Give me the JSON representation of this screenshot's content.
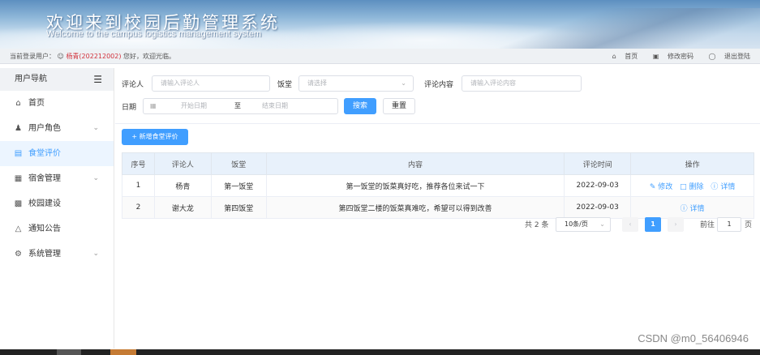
{
  "header": {
    "title_cn": "欢迎来到校园后勤管理系统",
    "title_en": "Welcome to the campus logistics management system"
  },
  "infobar": {
    "current_user_prefix": "当前登录用户：",
    "user": "杨青(202212002)",
    "greeting": "您好，欢迎光临。",
    "links": [
      "首页",
      "修改密码",
      "退出登陆"
    ]
  },
  "sidebar": {
    "title": "用户导航",
    "items": [
      {
        "label": "首页",
        "icon": "home-icon",
        "has_children": false,
        "active": false
      },
      {
        "label": "用户角色",
        "icon": "user-icon",
        "has_children": true,
        "active": false
      },
      {
        "label": "食堂评价",
        "icon": "document-icon",
        "has_children": false,
        "active": true
      },
      {
        "label": "宿舍管理",
        "icon": "building-icon",
        "has_children": true,
        "active": false
      },
      {
        "label": "校园建设",
        "icon": "office-icon",
        "has_children": false,
        "active": false
      },
      {
        "label": "通知公告",
        "icon": "bell-icon",
        "has_children": false,
        "active": false
      },
      {
        "label": "系统管理",
        "icon": "gear-icon",
        "has_children": true,
        "active": false
      }
    ]
  },
  "filter": {
    "reviewer_label": "评论人",
    "reviewer_placeholder": "请输入评论人",
    "canteen_label": "饭堂",
    "canteen_placeholder": "请选择",
    "content_label": "评论内容",
    "content_placeholder": "请输入评论内容",
    "date_label": "日期",
    "start_placeholder": "开始日期",
    "range_sep": "至",
    "end_placeholder": "结束日期",
    "search_label": "搜索",
    "reset_label": "重置"
  },
  "add_button": "+ 新增食堂评价",
  "table": {
    "headers": [
      "序号",
      "评论人",
      "饭堂",
      "内容",
      "评论时间",
      "操作"
    ],
    "rows": [
      {
        "no": "1",
        "reviewer": "杨青",
        "canteen": "第一饭堂",
        "content": "第一饭堂的饭菜真好吃，推荐各位来试一下",
        "time": "2022-09-03",
        "ops": [
          "修改",
          "删除",
          "详情"
        ]
      },
      {
        "no": "2",
        "reviewer": "谢大龙",
        "canteen": "第四饭堂",
        "content": "第四饭堂二楼的饭菜真难吃，希望可以得到改善",
        "time": "2022-09-03",
        "ops": [
          "详情"
        ]
      }
    ]
  },
  "pagination": {
    "total": "共 2 条",
    "page_size": "10条/页",
    "current_page": "1",
    "goto_prefix": "前往",
    "goto_value": "1",
    "goto_suffix": "页"
  },
  "watermark": "CSDN @m0_56406946",
  "colors": {
    "primary": "#409eff",
    "user_highlight": "#d2323c"
  }
}
